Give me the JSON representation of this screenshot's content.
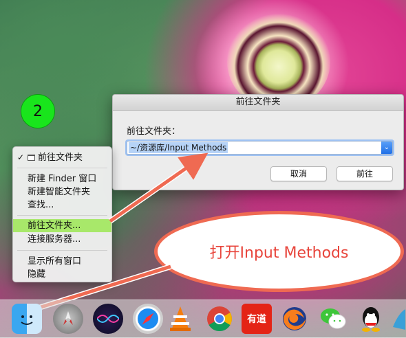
{
  "step_badge": "2",
  "dialog": {
    "title": "前往文件夹",
    "label": "前往文件夹：",
    "path_value": "~/资源库/Input Methods",
    "cancel_label": "取消",
    "go_label": "前往"
  },
  "context_menu": {
    "items": [
      {
        "label": "前往文件夹",
        "checked": true
      },
      {
        "label": "新建 Finder 窗口"
      },
      {
        "label": "新建智能文件夹"
      },
      {
        "label": "查找..."
      },
      {
        "label": "前往文件夹...",
        "highlighted": true
      },
      {
        "label": "连接服务器..."
      },
      {
        "label": "显示所有窗口"
      },
      {
        "label": "隐藏"
      }
    ]
  },
  "callout": {
    "text": "打开Input Methods"
  },
  "dock": {
    "icons": [
      "finder-icon",
      "launchpad-icon",
      "siri-icon",
      "safari-icon",
      "vlc-icon",
      "chrome-icon",
      "youdao-icon",
      "firefox-icon",
      "wechat-icon",
      "qq-icon"
    ],
    "youdao_text": "有道"
  },
  "colors": {
    "badge": "#19e51c",
    "highlight": "#a8e86a",
    "arrow": "#ef6a52",
    "callout_text": "#e8453c"
  }
}
